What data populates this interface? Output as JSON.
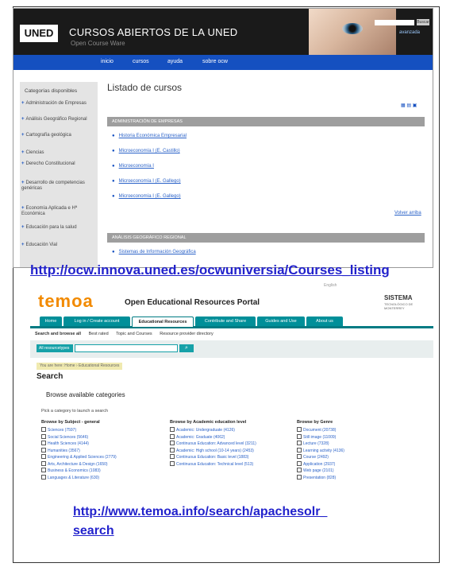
{
  "uned": {
    "logo": "UNED",
    "title": "CURSOS ABIERTOS DE LA UNED",
    "subtitle": "Open Course Ware",
    "search_button": "Buscar",
    "advanced": "avanzada",
    "nav": [
      "inicio",
      "cursos",
      "ayuda",
      "sobre ocw"
    ],
    "sidebar_title": "Categorías disponibles",
    "categories": [
      "Administración de Empresas",
      "Análisis Geográfico Regional",
      "Cartografía geológica",
      "Ciencias",
      "Derecho Constitucional",
      "Desarrollo de competencias genéricas",
      "Economía Aplicada e Hª Económica",
      "Educación para la salud",
      "Educación Vial"
    ],
    "page_title": "Listado de cursos",
    "sections": [
      {
        "title": "ADMINISTRACIÓN DE EMPRESAS",
        "courses": [
          "Historia Económica Empresarial",
          "Microeconomía I (E. Castillo)",
          "Microeconomía I",
          "Microeconomía I (E. Gallego)",
          "Microeconomía I (E. Gallego)"
        ],
        "more": "Volver arriba"
      },
      {
        "title": "ANÁLISIS GEOGRÁFICO REGIONAL",
        "courses": [
          "Sistemas de Información Geográfica"
        ],
        "more": ""
      }
    ]
  },
  "url1": "http://ocw.innova.uned.es/ocwuniversia/Courses_listing",
  "temoa": {
    "top_links": "English",
    "logo": "temoa",
    "portal_title": "Open Educational Resources Portal",
    "sistema": "SISTEMA",
    "sistema_sub": "TECNOLÓGICO DE MONTERREY",
    "tabs": [
      "Home",
      "Log in / Create account",
      "Educational Resources",
      "Contribute and Share",
      "Guides and Use",
      "About us"
    ],
    "subnav": [
      "Search and browse all",
      "Best rated",
      "Topic and Courses",
      "Resource provider directory"
    ],
    "search_select": "All resourcetypes",
    "search_go": "⌕",
    "breadcrumb": "You are here: Home › Educational Resources",
    "heading": "Search",
    "browse_heading": "Browse available categories",
    "pick_text": "Pick a category to launch a search",
    "columns": [
      {
        "title": "Browse by Subject - general",
        "items": [
          "Sciences (7597)",
          "Social Sciences (5646)",
          "Health Sciences (4144)",
          "Humanities (3567)",
          "Engineering & Applied Sciences (2779)",
          "Arts, Architecture & Design (1650)",
          "Business & Economics (1083)",
          "Languages & Literature (630)"
        ]
      },
      {
        "title": "Browse by Academic education level",
        "items": [
          "Academic: Undergraduate (4126)",
          "Academic: Graduate (4062)",
          "Continuous Education: Advanced level (3211)",
          "Academic: High school (10-14 years) (2453)",
          "Continuous Education: Basic level (1883)",
          "Continuous Education: Technical level (513)"
        ]
      },
      {
        "title": "Browse by Genre",
        "items": [
          "Document (20738)",
          "Still image (11009)",
          "Lecture (7328)",
          "Learning activity (4136)",
          "Course (2492)",
          "Application (2937)",
          "Web page (2101)",
          "Presentation (828)"
        ]
      }
    ]
  },
  "url2": [
    "http://www.temoa.info/search/apachesolr_",
    "search"
  ]
}
